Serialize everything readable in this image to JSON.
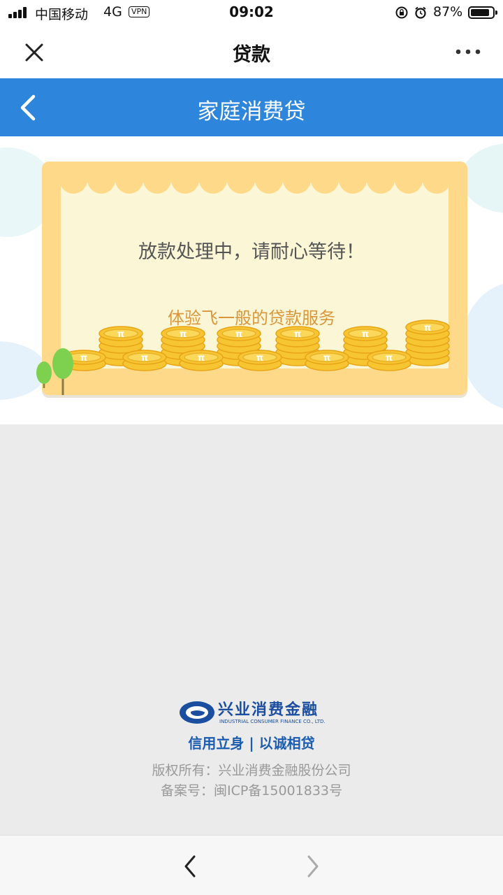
{
  "status": {
    "carrier": "中国移动",
    "network": "4G",
    "vpn": "VPN",
    "time": "09:02",
    "battery_percent": "87%",
    "battery_level": 0.87
  },
  "navbar": {
    "title": "贷款"
  },
  "app": {
    "title": "家庭消费贷"
  },
  "card": {
    "message": "放款处理中，请耐心等待！",
    "subtitle": "体验飞一般的贷款服务"
  },
  "footer": {
    "brand_name": "兴业消费金融",
    "brand_en": "INDUSTRIAL CONSUMER FINANCE CO., LTD.",
    "slogan": "信用立身 | 以诚相贷",
    "copyright": "版权所有：兴业消费金融股份公司",
    "icp": "备案号：闽ICP备15001833号"
  },
  "colors": {
    "accent": "#2d86dc",
    "card_border": "#ffd98a",
    "card_fill": "#fbf6d6",
    "coin": "#f6c531",
    "subtitle": "#d9963a",
    "brand": "#1c4ea0"
  },
  "icons": {
    "close": "close-icon",
    "more": "more-dots-icon",
    "back": "chevron-left-icon",
    "toolbar_back": "chevron-left-icon",
    "toolbar_forward": "chevron-right-icon"
  }
}
